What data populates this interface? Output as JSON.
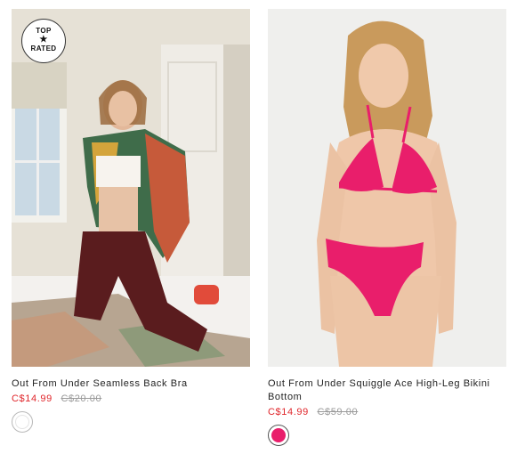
{
  "products": [
    {
      "name": "Out From Under Seamless Back Bra",
      "sale_price": "C$14.99",
      "original_price": "C$20.00",
      "badge": {
        "line1": "TOP",
        "icon": "star-icon",
        "line2": "RATED"
      },
      "swatch_color": "#ffffff"
    },
    {
      "name": "Out From Under Squiggle Ace High-Leg Bikini Bottom",
      "sale_price": "C$14.99",
      "original_price": "C$59.00",
      "swatch_color": "#e91e6b"
    }
  ],
  "colors": {
    "sale": "#e0262b",
    "strike": "#9a9a9a",
    "text": "#222222"
  }
}
